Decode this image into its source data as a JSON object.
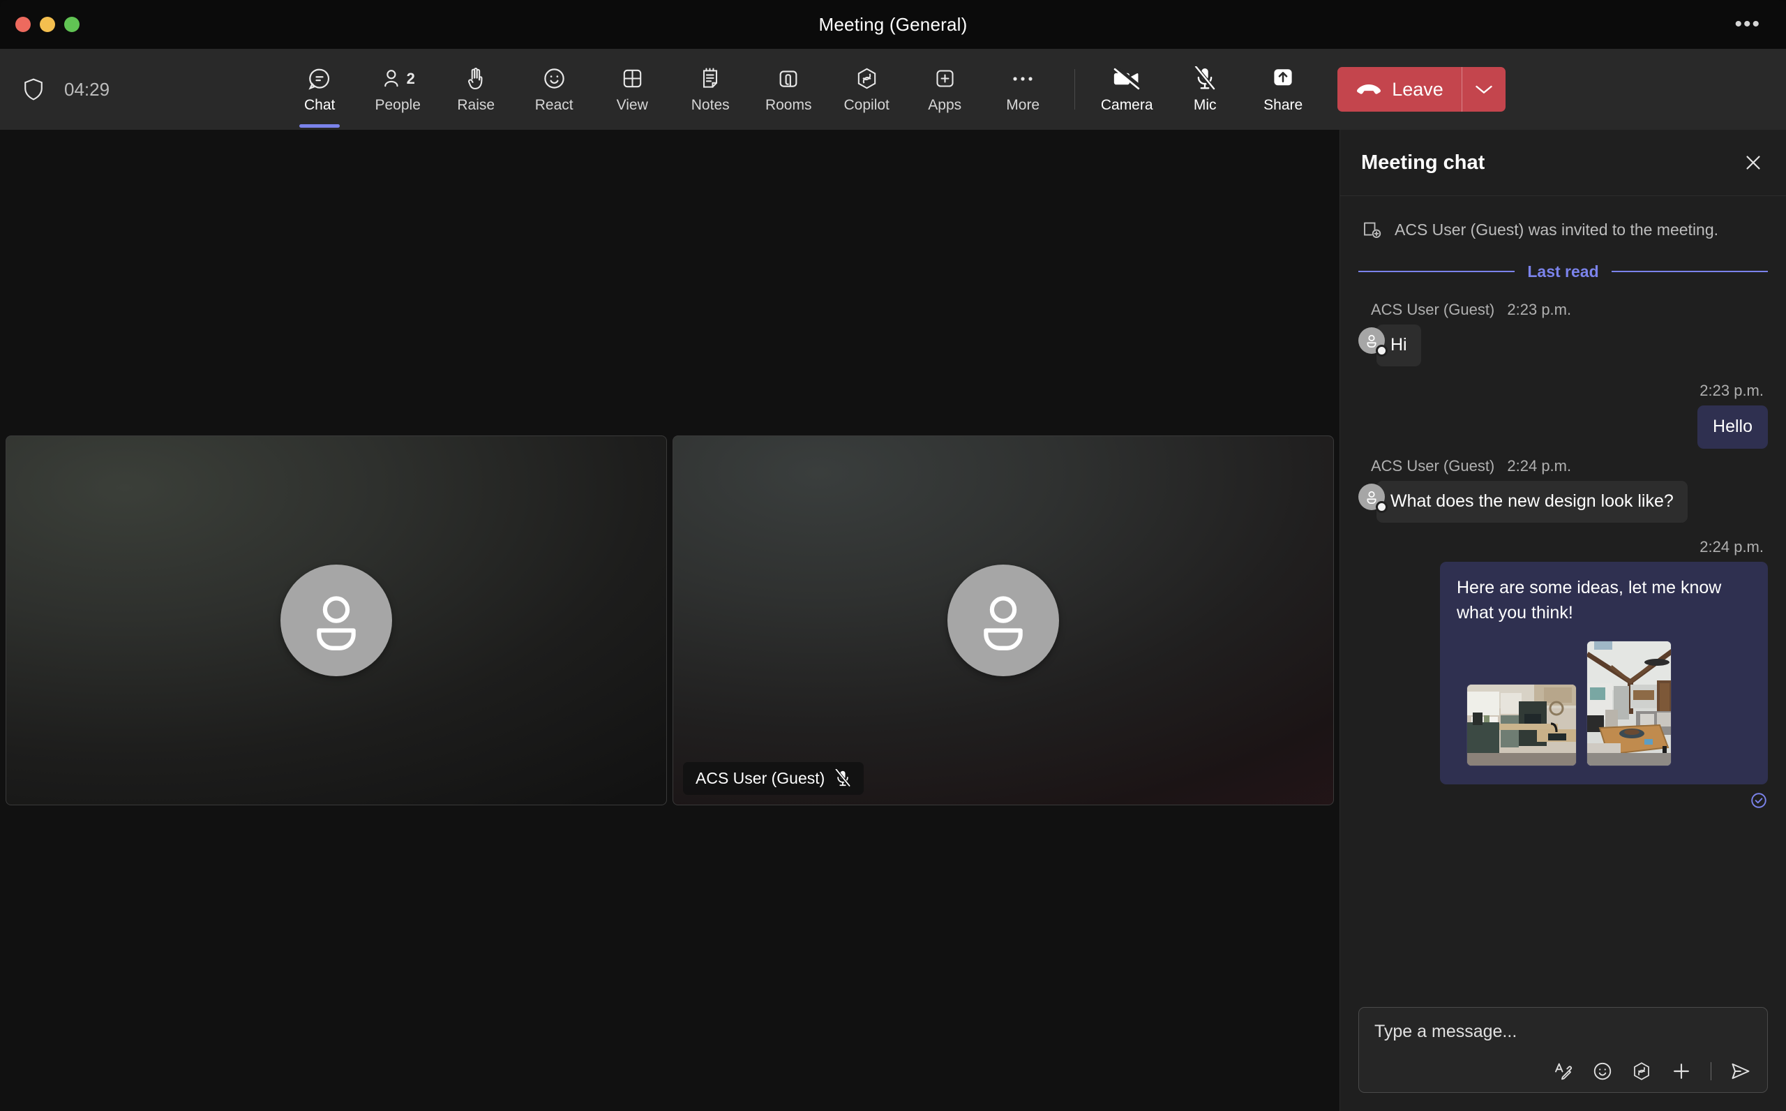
{
  "window": {
    "title": "Meeting (General)",
    "more_label": "•••"
  },
  "toolbar": {
    "timer": "04:29",
    "shield_icon": "shield-icon",
    "buttons": [
      {
        "label": "Chat",
        "icon": "chat-icon",
        "active": true,
        "badge": ""
      },
      {
        "label": "People",
        "icon": "people-icon",
        "active": false,
        "badge": "2"
      },
      {
        "label": "Raise",
        "icon": "raise-hand-icon",
        "active": false,
        "badge": ""
      },
      {
        "label": "React",
        "icon": "react-icon",
        "active": false,
        "badge": ""
      },
      {
        "label": "View",
        "icon": "view-grid-icon",
        "active": false,
        "badge": ""
      },
      {
        "label": "Notes",
        "icon": "notes-icon",
        "active": false,
        "badge": ""
      },
      {
        "label": "Rooms",
        "icon": "rooms-icon",
        "active": false,
        "badge": ""
      },
      {
        "label": "Copilot",
        "icon": "copilot-icon",
        "active": false,
        "badge": ""
      },
      {
        "label": "Apps",
        "icon": "apps-plus-icon",
        "active": false,
        "badge": ""
      },
      {
        "label": "More",
        "icon": "more-dots-icon",
        "active": false,
        "badge": ""
      }
    ],
    "camera": {
      "label": "Camera",
      "icon": "camera-off-icon",
      "state": "off"
    },
    "mic": {
      "label": "Mic",
      "icon": "mic-off-icon",
      "state": "off"
    },
    "share": {
      "label": "Share",
      "icon": "share-screen-icon"
    },
    "leave": {
      "label": "Leave",
      "icon": "hangup-icon",
      "caret_icon": "chevron-down-icon",
      "color": "#c4454d"
    }
  },
  "stage": {
    "tiles": [
      {
        "name": "",
        "muted": false,
        "show_badge": false,
        "avatar_icon": "person-avatar-icon"
      },
      {
        "name": "ACS User (Guest)",
        "muted": true,
        "show_badge": true,
        "avatar_icon": "person-avatar-icon",
        "mic_icon": "mic-off-icon"
      }
    ]
  },
  "chat": {
    "title": "Meeting chat",
    "close_icon": "close-icon",
    "system_message": {
      "icon": "person-add-icon",
      "text": "ACS User (Guest) was invited to the meeting."
    },
    "last_read_label": "Last read",
    "accent_color": "#7b83eb",
    "messages": [
      {
        "direction": "in",
        "author": "ACS User (Guest)",
        "time": "2:23 p.m.",
        "text": "Hi",
        "avatar_icon": "person-avatar-icon"
      },
      {
        "direction": "out",
        "time": "2:23 p.m.",
        "text": "Hello"
      },
      {
        "direction": "in",
        "author": "ACS User (Guest)",
        "time": "2:24 p.m.",
        "text": "What does the new design look like?",
        "avatar_icon": "person-avatar-icon"
      },
      {
        "direction": "out",
        "time": "2:24 p.m.",
        "text": "Here are some ideas, let me know what you think!",
        "attachments": [
          {
            "name": "kitchen-interior-photo",
            "orientation": "landscape"
          },
          {
            "name": "living-room-interior-photo",
            "orientation": "portrait"
          }
        ],
        "receipt_icon": "read-receipt-check-icon"
      }
    ],
    "composer": {
      "placeholder": "Type a message...",
      "tools": [
        {
          "name": "format-text-icon"
        },
        {
          "name": "emoji-icon"
        },
        {
          "name": "copilot-icon"
        },
        {
          "name": "attach-plus-icon"
        },
        {
          "name": "send-icon"
        }
      ]
    }
  }
}
